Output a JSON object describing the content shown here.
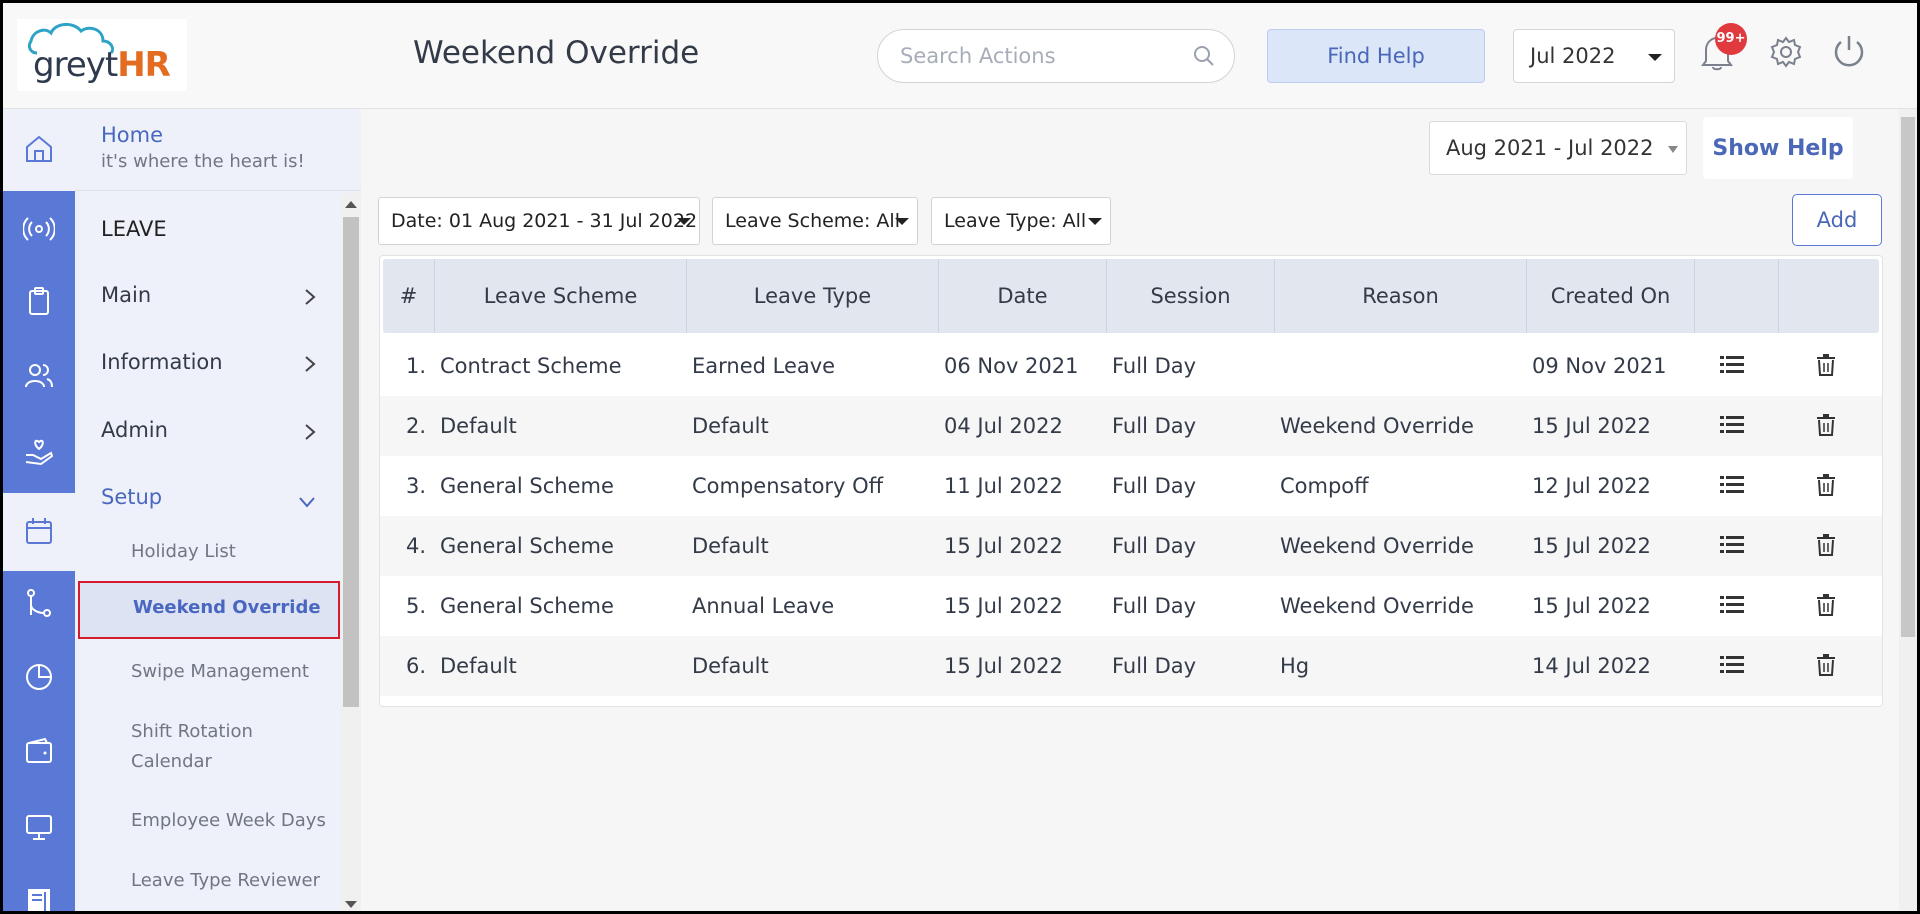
{
  "header": {
    "logo_text_grey": "greyt",
    "logo_text_hr": "HR",
    "page_title": "Weekend Override",
    "search_placeholder": "Search Actions",
    "find_help_label": "Find Help",
    "month_value": "Jul 2022",
    "notification_badge": "99+"
  },
  "sidebar": {
    "rail_icons": [
      "home-icon",
      "broadcast-icon",
      "clipboard-icon",
      "people-icon",
      "hand-heart-icon",
      "calendar-icon",
      "git-branch-icon",
      "pie-chart-icon",
      "wallet-icon",
      "monitor-icon",
      "document-icon"
    ],
    "home_title": "Home",
    "home_subtitle": "it's where the heart is!",
    "section_title": "LEAVE",
    "items": [
      {
        "label": "Main"
      },
      {
        "label": "Information"
      },
      {
        "label": "Admin"
      },
      {
        "label": "Setup"
      }
    ],
    "sub_items": [
      {
        "label": "Holiday List"
      },
      {
        "label": "Weekend Override"
      },
      {
        "label": "Swipe Management"
      },
      {
        "label": "Shift Rotation Calendar"
      },
      {
        "label": "Employee Week Days"
      },
      {
        "label": "Leave Type Reviewer"
      }
    ]
  },
  "main": {
    "period_value": "Aug 2021 - Jul 2022",
    "show_help_label": "Show Help",
    "filters": {
      "date": "Date: 01 Aug 2021 - 31 Jul 2022",
      "scheme": "Leave Scheme: All",
      "type": "Leave Type: All"
    },
    "add_label": "Add",
    "table": {
      "headers": [
        "#",
        "Leave Scheme",
        "Leave Type",
        "Date",
        "Session",
        "Reason",
        "Created On",
        "",
        ""
      ],
      "rows": [
        {
          "num": "1.",
          "scheme": "Contract Scheme",
          "type": "Earned Leave",
          "date": "06 Nov 2021",
          "session": "Full Day",
          "reason": "",
          "created": "09 Nov 2021"
        },
        {
          "num": "2.",
          "scheme": "Default",
          "type": "Default",
          "date": "04 Jul 2022",
          "session": "Full Day",
          "reason": "Weekend Override",
          "created": "15 Jul 2022"
        },
        {
          "num": "3.",
          "scheme": "General Scheme",
          "type": "Compensatory Off",
          "date": "11 Jul 2022",
          "session": "Full Day",
          "reason": "Compoff",
          "created": "12 Jul 2022"
        },
        {
          "num": "4.",
          "scheme": "General Scheme",
          "type": "Default",
          "date": "15 Jul 2022",
          "session": "Full Day",
          "reason": "Weekend Override",
          "created": "15 Jul 2022"
        },
        {
          "num": "5.",
          "scheme": "General Scheme",
          "type": "Annual Leave",
          "date": "15 Jul 2022",
          "session": "Full Day",
          "reason": "Weekend Override",
          "created": "15 Jul 2022"
        },
        {
          "num": "6.",
          "scheme": "Default",
          "type": "Default",
          "date": "15 Jul 2022",
          "session": "Full Day",
          "reason": "Hg",
          "created": "14 Jul 2022"
        }
      ]
    }
  },
  "colors": {
    "accent": "#5a79d6",
    "link": "#4a67c0",
    "badge": "#e0393e",
    "selected_outline": "#d41c2c"
  }
}
